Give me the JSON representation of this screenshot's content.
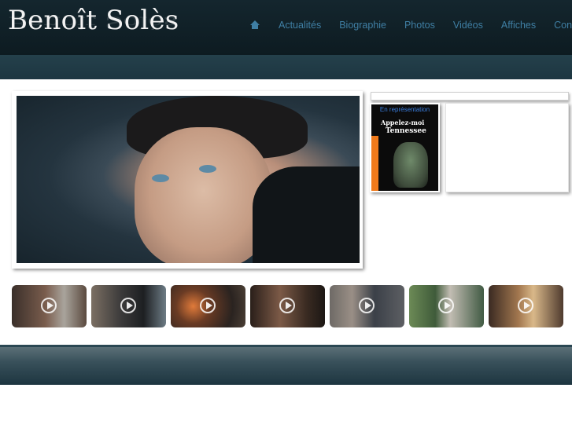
{
  "site": {
    "title": "Benoît Solès"
  },
  "nav": {
    "home_icon": "home-icon",
    "items": [
      "Actualités",
      "Biographie",
      "Photos",
      "Vidéos",
      "Affiches",
      "Contact"
    ],
    "color": "#3f7fa4"
  },
  "poster": {
    "label": "En représentation",
    "title_line1": "Appelez-moi",
    "title_line2": "Tennessee"
  },
  "thumbnails": [
    {
      "icon": "play-icon"
    },
    {
      "icon": "play-icon"
    },
    {
      "icon": "play-icon"
    },
    {
      "icon": "play-icon"
    },
    {
      "icon": "play-icon"
    },
    {
      "icon": "play-icon"
    },
    {
      "icon": "play-icon"
    }
  ]
}
